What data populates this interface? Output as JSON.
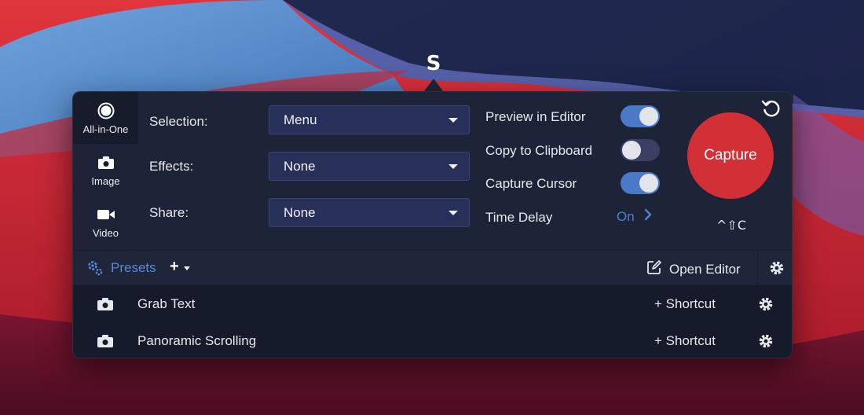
{
  "app": {
    "menubar_icon_glyph": "S",
    "accent": "#4f7fd2",
    "capture_color": "#d32f36"
  },
  "modes": [
    {
      "label": "All-in-One",
      "icon": "record-circle-icon",
      "active": true
    },
    {
      "label": "Image",
      "icon": "camera-icon",
      "active": false
    },
    {
      "label": "Video",
      "icon": "video-camera-icon",
      "active": false
    }
  ],
  "settings": {
    "selection": {
      "label": "Selection:",
      "value": "Menu"
    },
    "effects": {
      "label": "Effects:",
      "value": "None"
    },
    "share": {
      "label": "Share:",
      "value": "None"
    }
  },
  "options": {
    "preview_in_editor": {
      "label": "Preview in Editor",
      "on": true
    },
    "copy_to_clipboard": {
      "label": "Copy to Clipboard",
      "on": false
    },
    "capture_cursor": {
      "label": "Capture Cursor",
      "on": true
    },
    "time_delay": {
      "label": "Time Delay",
      "value": "On"
    }
  },
  "capture": {
    "label": "Capture",
    "shortcut": "^⇧C"
  },
  "toolbar": {
    "presets_label": "Presets",
    "add_glyph": "+",
    "open_editor_label": "Open Editor"
  },
  "presets": [
    {
      "name": "Grab Text",
      "shortcut_label": "+ Shortcut"
    },
    {
      "name": "Panoramic Scrolling",
      "shortcut_label": "+ Shortcut"
    }
  ]
}
